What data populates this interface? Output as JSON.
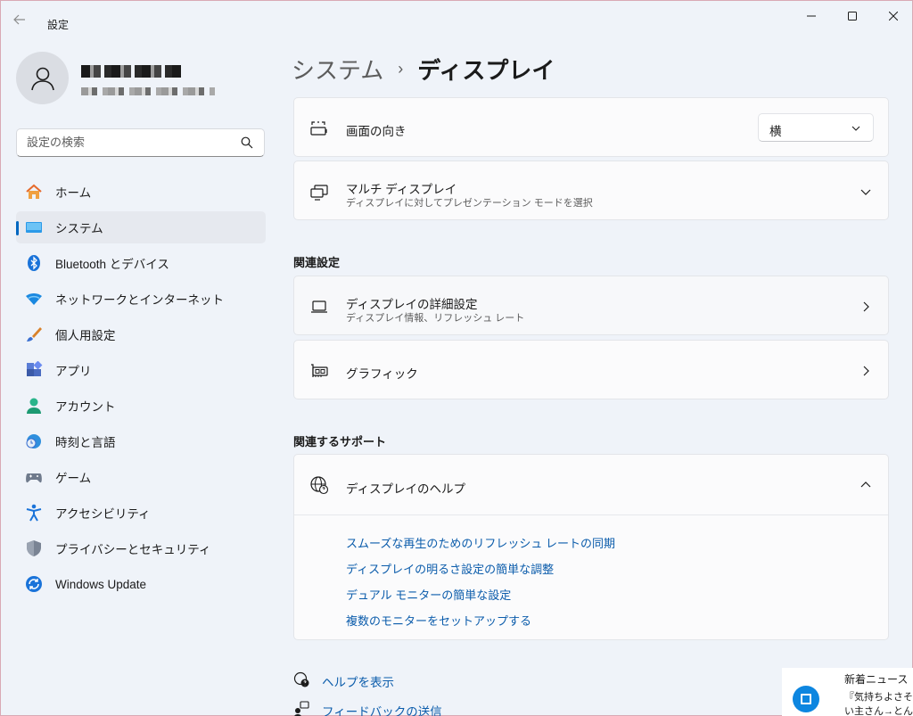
{
  "window": {
    "title": "設定"
  },
  "search": {
    "placeholder": "設定の検索"
  },
  "sidebar": {
    "items": [
      {
        "label": "ホーム",
        "icon": "home-icon"
      },
      {
        "label": "システム",
        "icon": "system-icon",
        "active": true
      },
      {
        "label": "Bluetooth とデバイス",
        "icon": "bluetooth-icon"
      },
      {
        "label": "ネットワークとインターネット",
        "icon": "wifi-icon"
      },
      {
        "label": "個人用設定",
        "icon": "brush-icon"
      },
      {
        "label": "アプリ",
        "icon": "apps-icon"
      },
      {
        "label": "アカウント",
        "icon": "account-icon"
      },
      {
        "label": "時刻と言語",
        "icon": "globe-clock-icon"
      },
      {
        "label": "ゲーム",
        "icon": "gamepad-icon"
      },
      {
        "label": "アクセシビリティ",
        "icon": "accessibility-icon"
      },
      {
        "label": "プライバシーとセキュリティ",
        "icon": "shield-icon"
      },
      {
        "label": "Windows Update",
        "icon": "update-icon"
      }
    ]
  },
  "breadcrumb": {
    "parent": "システム",
    "separator": "›",
    "current": "ディスプレイ"
  },
  "cards": {
    "orientation": {
      "title": "画面の向き",
      "value": "横"
    },
    "multi_display": {
      "title": "マルチ ディスプレイ",
      "subtitle": "ディスプレイに対してプレゼンテーション モードを選択"
    }
  },
  "related": {
    "heading": "関連設定",
    "advanced": {
      "title": "ディスプレイの詳細設定",
      "subtitle": "ディスプレイ情報、リフレッシュ レート"
    },
    "graphics": {
      "title": "グラフィック"
    }
  },
  "support": {
    "heading": "関連するサポート",
    "help_title": "ディスプレイのヘルプ",
    "links": [
      "スムーズな再生のためのリフレッシュ レートの同期",
      "ディスプレイの明るさ設定の簡単な調整",
      "デュアル モニターの簡単な設定",
      "複数のモニターをセットアップする"
    ]
  },
  "footer": {
    "help": "ヘルプを表示",
    "feedback": "フィードバックの送信"
  },
  "news": {
    "title": "新着ニュース",
    "line1": "『気持ちよさそう",
    "line2": "い主さん→とんで"
  },
  "colors": {
    "accent": "#0067c0",
    "link": "#0b5cab",
    "background": "#eff3f9"
  }
}
